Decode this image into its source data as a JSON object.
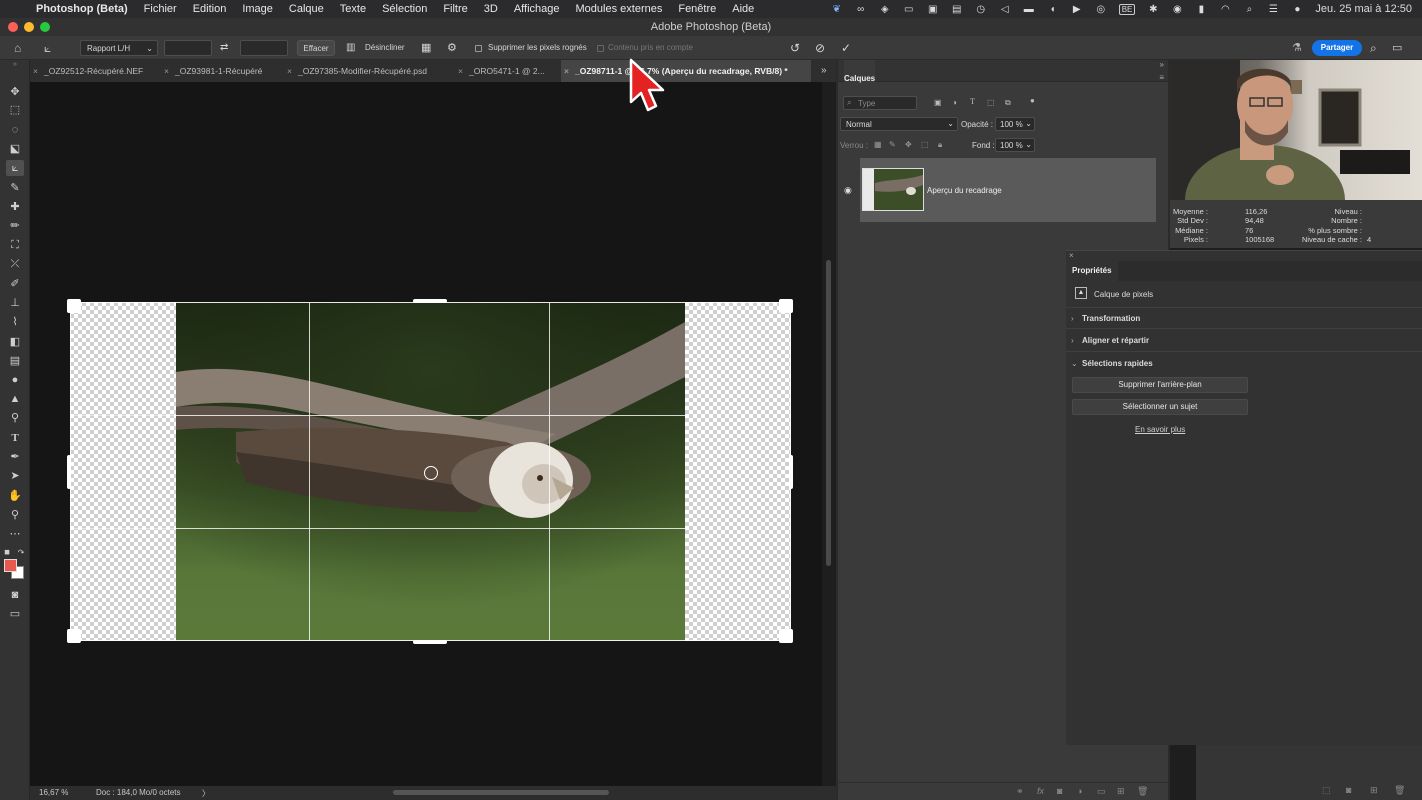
{
  "menubar": {
    "app_name": "Photoshop (Beta)",
    "items": [
      "Fichier",
      "Edition",
      "Image",
      "Calque",
      "Texte",
      "Sélection",
      "Filtre",
      "3D",
      "Affichage",
      "Modules externes",
      "Fenêtre",
      "Aide"
    ],
    "datetime": "Jeu. 25 mai à 12:50",
    "region_badge": "BE"
  },
  "window": {
    "title": "Adobe Photoshop (Beta)"
  },
  "options": {
    "ratio": "Rapport L/H",
    "clear_label": "Effacer",
    "straighten_label": "Désincliner",
    "delete_cropped_label": "Supprimer les pixels rognés",
    "content_aware_label": "Contenu pris en compte",
    "share_label": "Partager"
  },
  "tabs": [
    {
      "label": "_OZ92512-Récupéré.NEF"
    },
    {
      "label": "_OZ93981-1-Récupéré"
    },
    {
      "label": "_OZ97385-Modifier-Récupéré.psd"
    },
    {
      "label": "_ORO5471-1 @ 2..."
    },
    {
      "label": "_OZ98711-1 @ 16,7% (Aperçu du recadrage, RVB/8) *"
    }
  ],
  "status": {
    "zoom": "16,67 %",
    "doc": "Doc : 184,0 Mo/0 octets",
    "arrow": "〉"
  },
  "layers": {
    "title": "Calques",
    "filter_placeholder": "Type",
    "blend_mode": "Normal",
    "opacity_label": "Opacité :",
    "opacity_value": "100 %",
    "lock_label": "Verrou :",
    "fill_label": "Fond :",
    "fill_value": "100 %",
    "layer_name": "Aperçu du recadrage"
  },
  "info": {
    "moyenne_label": "Moyenne :",
    "moyenne": "116,26",
    "stddev_label": "Std Dev :",
    "stddev": "94,48",
    "mediane_label": "Médiane :",
    "mediane": "76",
    "pixels_label": "Pixels :",
    "pixels": "1005168",
    "niveau_label": "Niveau :",
    "nombre_label": "Nombre :",
    "sombre_label": "% plus sombre :",
    "cache_label": "Niveau de cache :",
    "cache": "4"
  },
  "properties": {
    "title": "Propriétés",
    "layer_type": "Calque de pixels",
    "sections": [
      "Transformation",
      "Aligner et répartir",
      "Sélections rapides"
    ],
    "remove_bg": "Supprimer l'arrière-plan",
    "select_subject": "Sélectionner un sujet",
    "learn_more": "En savoir plus"
  },
  "colors": {
    "foreground": "#e8584f",
    "background": "#ffffff",
    "accent": "#1473e6",
    "cursor": "#e52222"
  }
}
